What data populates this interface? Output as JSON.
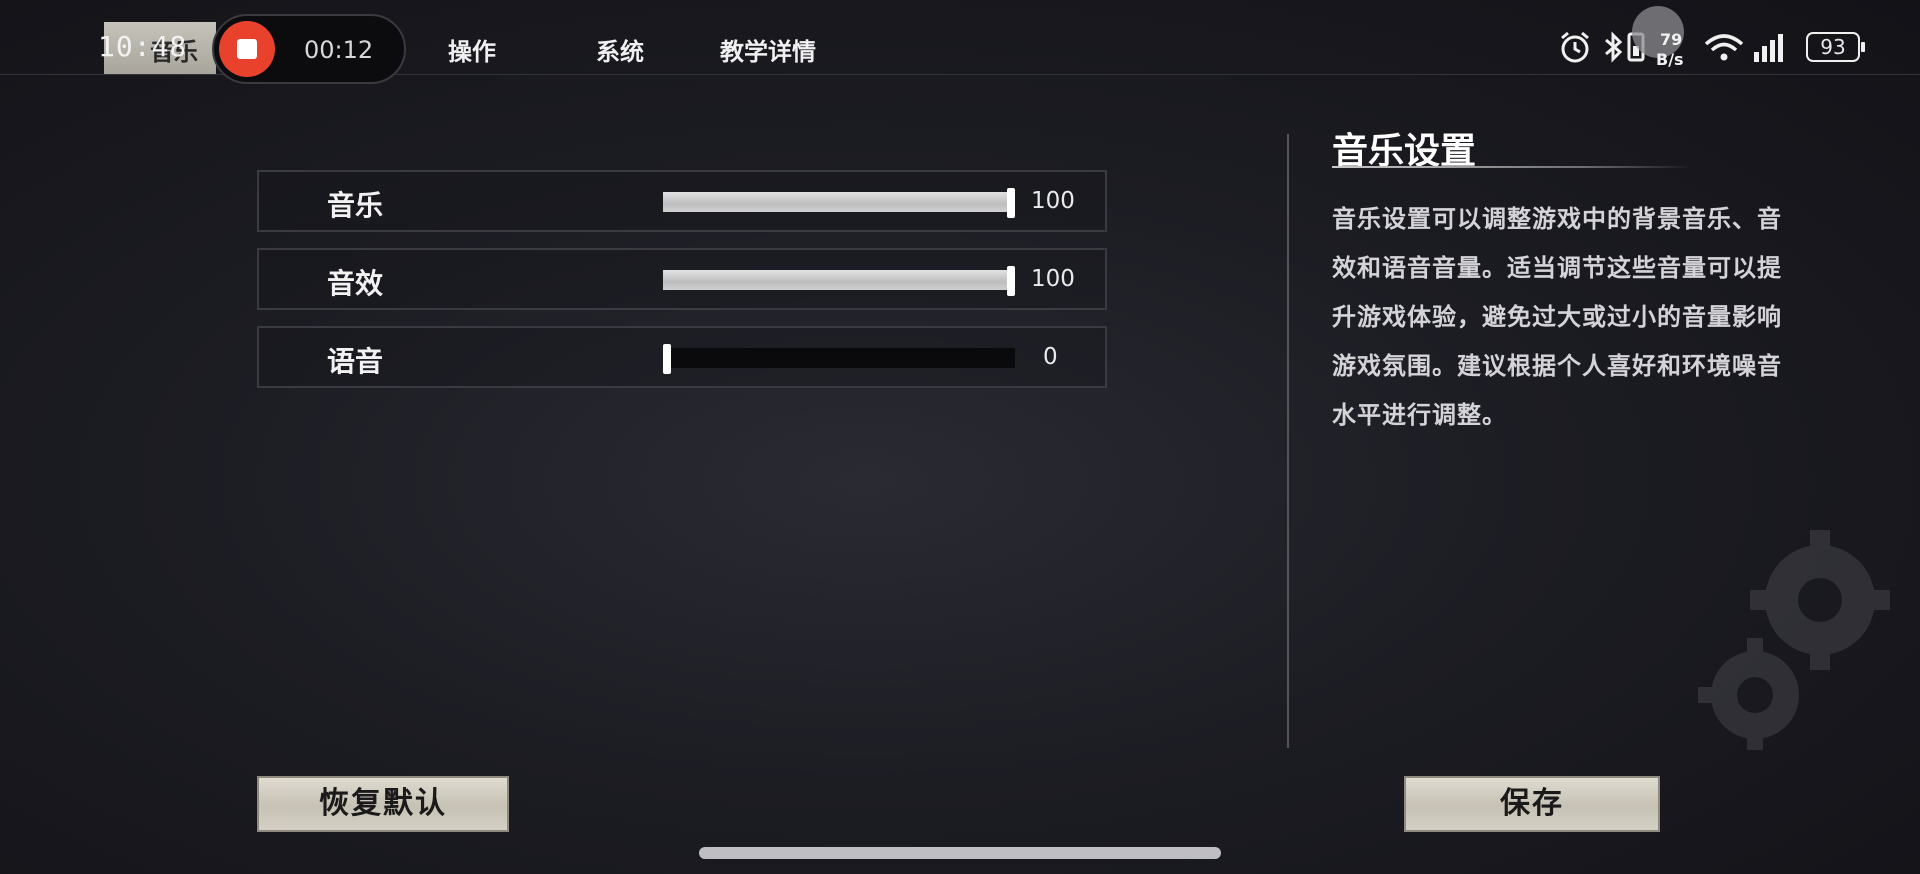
{
  "status_bar": {
    "time": "10:48",
    "recording_time": "00:12",
    "net_speed_value": "79",
    "net_speed_unit": "B/s",
    "battery": "93"
  },
  "tabs": [
    {
      "label": "音乐",
      "active": true
    },
    {
      "label": "操作",
      "active": false
    },
    {
      "label": "系统",
      "active": false
    },
    {
      "label": "教学详情",
      "active": false
    }
  ],
  "sliders": [
    {
      "label": "音乐",
      "value": "100",
      "level": 1.0
    },
    {
      "label": "音效",
      "value": "100",
      "level": 1.0
    },
    {
      "label": "语音",
      "value": "0",
      "level": 0.0
    }
  ],
  "info_panel": {
    "title": "音乐设置",
    "description": "音乐设置可以调整游戏中的背景音乐、音效和语音音量。适当调节这些音量可以提升游戏体验，避免过大或过小的音量影响游戏氛围。建议根据个人喜好和环境噪音水平进行调整。"
  },
  "buttons": {
    "reset": "恢复默认",
    "save": "保存"
  },
  "colors": {
    "record_red": "#e8412c",
    "parchment": "#d4d0c5"
  }
}
